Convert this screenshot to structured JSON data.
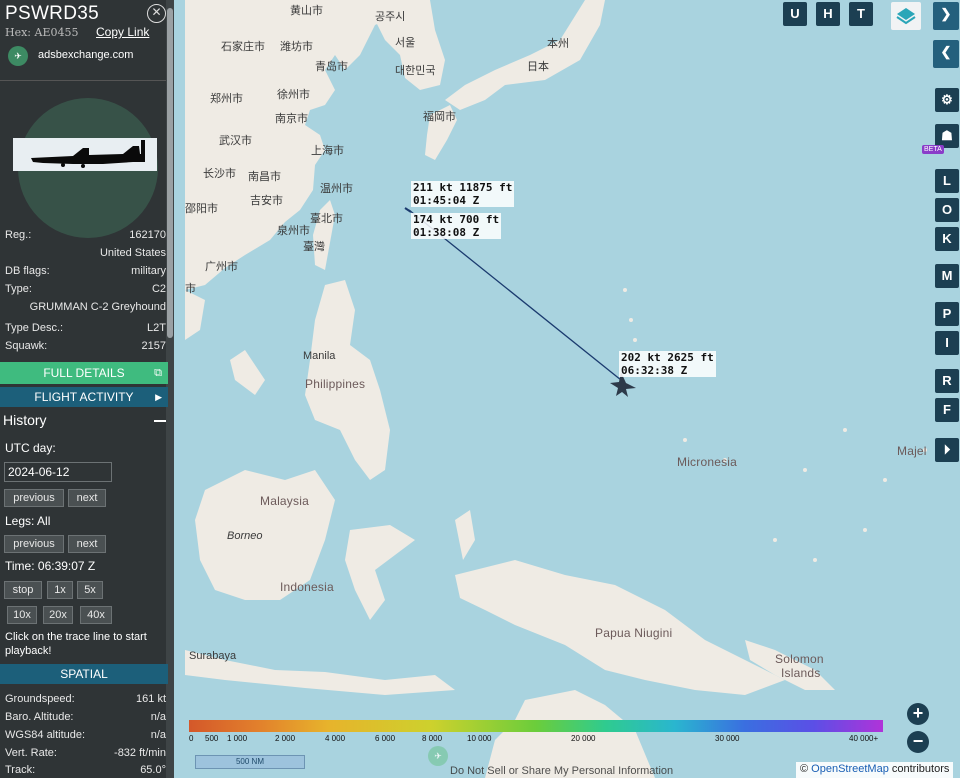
{
  "aircraft": {
    "callsign": "PSWRD35",
    "hex_label": "Hex:",
    "hex_value": "AE0455",
    "copy_link": "Copy Link",
    "source_name": "adsbexchange.com",
    "reg_label": "Reg.:",
    "reg_value": "162170",
    "country": "United States",
    "db_flags_label": "DB flags:",
    "db_flags_value": "military",
    "type_label": "Type:",
    "type_value": "C2",
    "type_full": "GRUMMAN C-2 Greyhound",
    "type_desc_label": "Type Desc.:",
    "type_desc_value": "L2T",
    "squawk_label": "Squawk:",
    "squawk_value": "2157"
  },
  "buttons": {
    "full_details": "FULL DETAILS",
    "flight_activity": "FLIGHT ACTIVITY"
  },
  "history": {
    "title": "History",
    "utc_day_label": "UTC day:",
    "date_value": "2024-06-12",
    "previous": "previous",
    "next": "next",
    "legs_label": "Legs: All",
    "time_label": "Time: 06:39:07 Z",
    "speed_buttons": [
      "stop",
      "1x",
      "5x",
      "10x",
      "20x",
      "40x"
    ],
    "help_text": "Click on the trace line to start playback!"
  },
  "spatial": {
    "title": "SPATIAL",
    "groundspeed_label": "Groundspeed:",
    "groundspeed_value": "161 kt",
    "baro_label": "Baro. Altitude:",
    "baro_value": "n/a",
    "wgs_label": "WGS84 altitude:",
    "wgs_value": "n/a",
    "vert_label": "Vert. Rate:",
    "vert_value": "-832 ft/min",
    "track_label": "Track:",
    "track_value": "65.0°"
  },
  "flight_labels": [
    {
      "line1": "211 kt  11875 ft",
      "line2": "01:45:04 Z"
    },
    {
      "line1": "174 kt  700 ft",
      "line2": "01:38:08 Z"
    },
    {
      "line1": "202 kt  2625 ft",
      "line2": "06:32:38 Z"
    }
  ],
  "map_labels": {
    "shandong": "黄山市",
    "seoul_k": "공주시",
    "seoul": "서울",
    "korea": "대한민국",
    "shijiazhuang": "石家庄市",
    "weifang": "潍坊市",
    "qingdao": "青岛市",
    "honshu": "本州",
    "japan": "日本",
    "zhengzhou": "郑州市",
    "xuzhou": "徐州市",
    "fukuoka": "福岡市",
    "nanjing": "南京市",
    "wuhan": "武汉市",
    "shanghai": "上海市",
    "changsha": "长沙市",
    "nanchang": "南昌市",
    "wenzhou": "温州市",
    "shaoyang": "邵阳市",
    "jian": "吉安市",
    "quanzhou": "泉州市",
    "taipei": "臺北市",
    "guangzhou": "广州市",
    "taiwan": "臺灣",
    "shi": "市",
    "manila": "Manila",
    "philippines": "Philippines",
    "micronesia": "Micronesia",
    "majel": "Majel",
    "malaysia": "Malaysia",
    "borneo": "Borneo",
    "indonesia": "Indonesia",
    "papua": "Papua Niugini",
    "surabaya": "Surabaya",
    "solomon1": "Solomon",
    "solomon2": "Islands"
  },
  "map_controls": {
    "top_buttons": [
      "U",
      "H",
      "T"
    ],
    "side_letters": [
      "L",
      "O",
      "K",
      "M",
      "P",
      "I",
      "R",
      "F"
    ],
    "beta": "BETA",
    "zoom_in": "+",
    "zoom_out": "−"
  },
  "altitude_legend": {
    "ticks": [
      "0",
      "500",
      "1 000",
      "2 000",
      "4 000",
      "6 000",
      "8 000",
      "10 000",
      "20 000",
      "30 000",
      "40 000+"
    ]
  },
  "footer": {
    "scale": "500 NM",
    "do_not_sell": "Do Not Sell or Share My Personal Information",
    "attribution_prefix": "©",
    "attribution_link": "OpenStreetMap",
    "attribution_suffix": "contributors"
  }
}
